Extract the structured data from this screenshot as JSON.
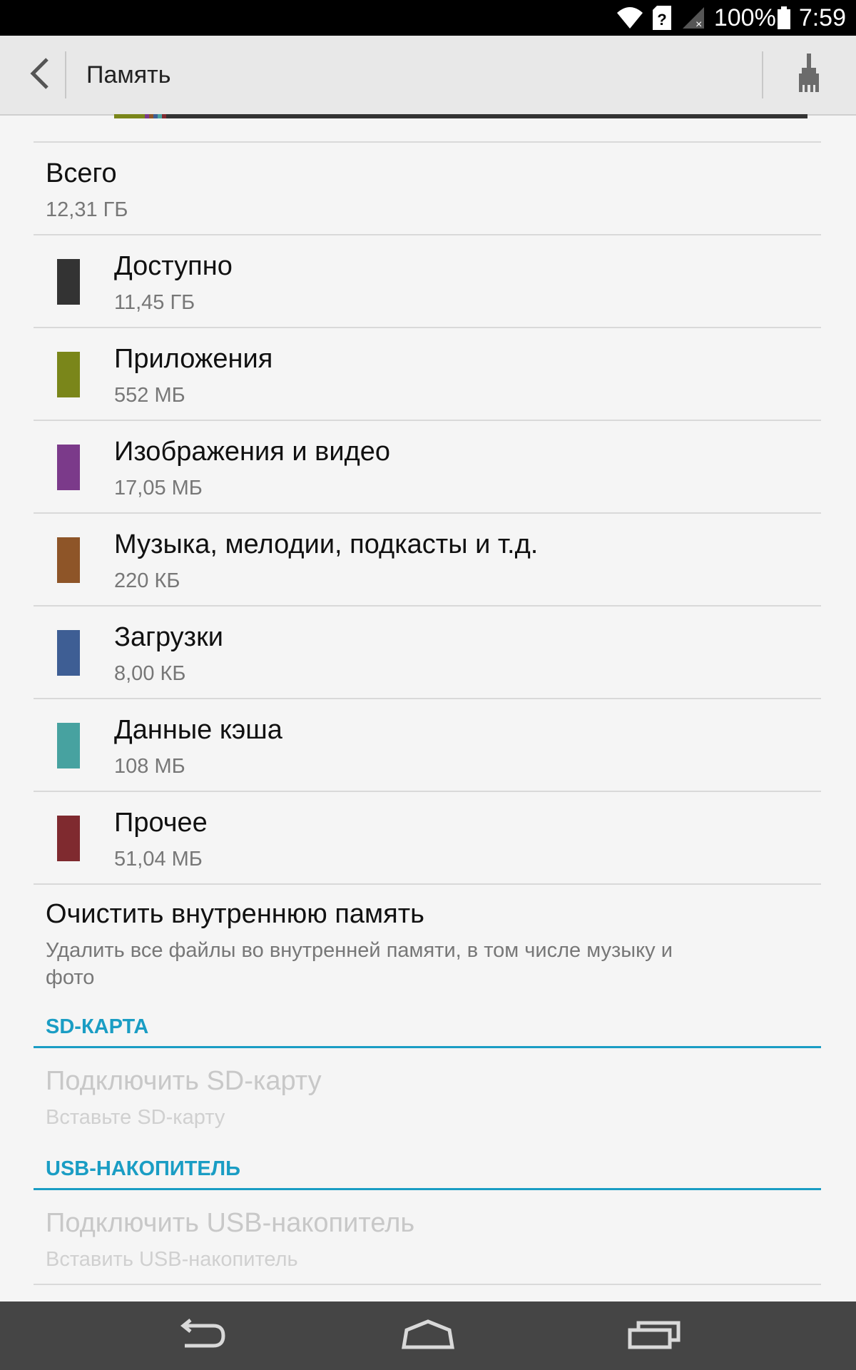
{
  "status_bar": {
    "battery_percent": "100%",
    "time": "7:59",
    "icons": [
      "wifi-icon",
      "sim-unknown-icon",
      "signal-no-service-icon",
      "battery-full-icon"
    ]
  },
  "action_bar": {
    "title": "Память",
    "back_icon": "back-arrow-icon",
    "clean_icon": "broom-icon"
  },
  "usage_bar": {
    "segments": [
      {
        "name": "Приложения",
        "color": "#7a861a",
        "fraction": 0.044
      },
      {
        "name": "Изображения и видео",
        "color": "#7b3a8a",
        "fraction": 0.006
      },
      {
        "name": "Музыка",
        "color": "#8e5528",
        "fraction": 0.006
      },
      {
        "name": "Загрузки",
        "color": "#3e5e94",
        "fraction": 0.006
      },
      {
        "name": "Данные кэша",
        "color": "#47a2a0",
        "fraction": 0.006
      },
      {
        "name": "Прочее",
        "color": "#7f2a2f",
        "fraction": 0.006
      },
      {
        "name": "Доступно",
        "color": "#333333",
        "fraction": 0.926
      }
    ]
  },
  "total": {
    "label": "Всего",
    "value": "12,31 ГБ"
  },
  "categories": [
    {
      "label": "Доступно",
      "value": "11,45 ГБ",
      "color": "#333333"
    },
    {
      "label": "Приложения",
      "value": "552 МБ",
      "color": "#7a861a"
    },
    {
      "label": "Изображения и видео",
      "value": "17,05 МБ",
      "color": "#7b3a8a"
    },
    {
      "label": "Музыка, мелодии, подкасты и т.д.",
      "value": "220 КБ",
      "color": "#8e5528"
    },
    {
      "label": "Загрузки",
      "value": "8,00 КБ",
      "color": "#3e5e94"
    },
    {
      "label": "Данные кэша",
      "value": "108 МБ",
      "color": "#47a2a0"
    },
    {
      "label": "Прочее",
      "value": "51,04 МБ",
      "color": "#7f2a2f"
    }
  ],
  "wipe": {
    "title": "Очистить внутреннюю память",
    "subtitle_line1": "Удалить все файлы во внутренней памяти, в том числе музыку и",
    "subtitle_line2": "фото"
  },
  "sd_section": {
    "header": "SD-КАРТА",
    "title": "Подключить SD-карту",
    "subtitle": "Вставьте SD-карту"
  },
  "usb_section": {
    "header": "USB-НАКОПИТЕЛЬ",
    "title": "Подключить USB-накопитель",
    "subtitle": "Вставить USB-накопитель"
  },
  "nav_bar": {
    "icons": [
      "nav-back-icon",
      "nav-home-icon",
      "nav-recents-icon"
    ]
  },
  "colors": {
    "accent": "#1a9dc4",
    "status_bar": "#000000",
    "nav_bar": "#454545"
  }
}
